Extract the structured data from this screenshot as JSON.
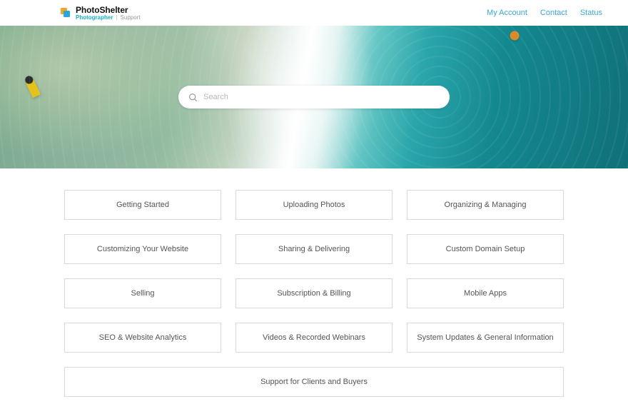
{
  "header": {
    "brand_name": "PhotoShelter",
    "product_line": "Photographer",
    "section": "Support",
    "nav": {
      "account": "My Account",
      "contact": "Contact",
      "status": "Status"
    }
  },
  "search": {
    "placeholder": "Search"
  },
  "categories": [
    {
      "label": "Getting Started"
    },
    {
      "label": "Uploading Photos"
    },
    {
      "label": "Organizing & Managing"
    },
    {
      "label": "Customizing Your Website"
    },
    {
      "label": "Sharing & Delivering"
    },
    {
      "label": "Custom Domain Setup"
    },
    {
      "label": "Selling"
    },
    {
      "label": "Subscription & Billing"
    },
    {
      "label": "Mobile Apps"
    },
    {
      "label": "SEO & Website Analytics"
    },
    {
      "label": "Videos & Recorded Webinars"
    },
    {
      "label": "System Updates & General Information"
    },
    {
      "label": "Support for Clients and Buyers",
      "wide": true
    }
  ]
}
